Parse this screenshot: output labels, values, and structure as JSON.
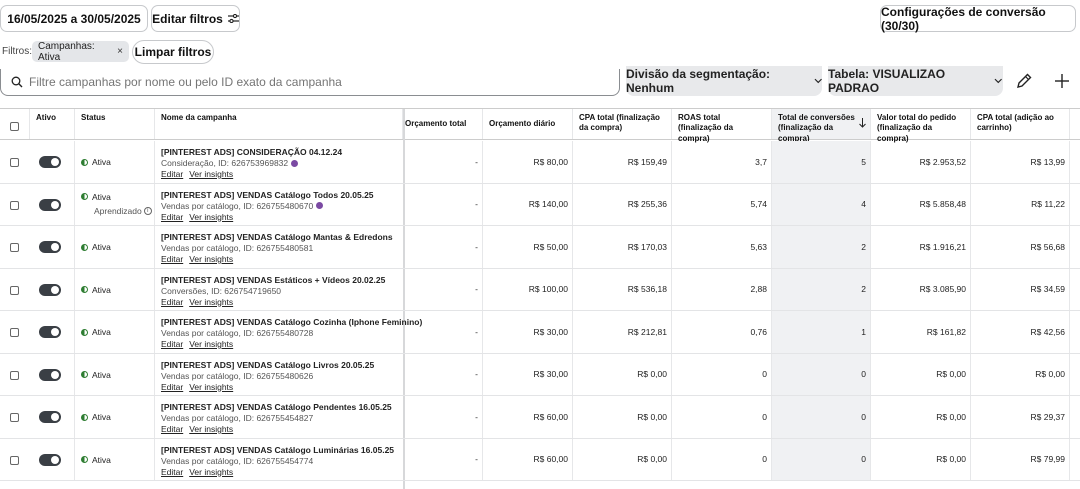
{
  "toolbar": {
    "date_range": "16/05/2025 a 30/05/2025",
    "edit_filters": "Editar filtros",
    "conversion_settings": "Configurações de conversão (30/30)"
  },
  "filters": {
    "label": "Filtros:",
    "chip": "Campanhas: Ativa",
    "chip_close": "×",
    "clear": "Limpar filtros"
  },
  "search": {
    "placeholder": "Filtre campanhas por nome ou pelo ID exato da campanha"
  },
  "segmentation": "Divisão da segmentação: Nenhum",
  "table_view": "Tabela: VISUALIZAO PADRAO",
  "columns": [
    "Ativo",
    "Status",
    "Nome da campanha",
    "Orçamento total",
    "Orçamento diário",
    "CPA total (finalização da compra)",
    "ROAS total (finalização da compra)",
    "Total de conversões (finalização da compra)",
    "Valor total do pedido (finalização da compra)",
    "CPA total (adição ao carrinho)"
  ],
  "row_links": {
    "edit": "Editar",
    "insights": "Ver insights"
  },
  "learning_label": "Aprendizado",
  "rows": [
    {
      "name": "[PINTEREST ADS] CONSIDERAÇÃO 04.12.24",
      "sub": "Consideração, ID: 626753969832",
      "status": "Ativa",
      "total_budget": "-",
      "daily": "R$ 80,00",
      "cpa": "R$ 159,49",
      "roas": "3,7",
      "conv": "5",
      "value": "R$ 2.953,52",
      "cpa_cart": "R$ 13,99",
      "dot": true,
      "learning": false
    },
    {
      "name": "[PINTEREST ADS] VENDAS Catálogo Todos 20.05.25",
      "sub": "Vendas por catálogo, ID: 626755480670",
      "status": "Ativa",
      "total_budget": "-",
      "daily": "R$ 140,00",
      "cpa": "R$ 255,36",
      "roas": "5,74",
      "conv": "4",
      "value": "R$ 5.858,48",
      "cpa_cart": "R$ 11,22",
      "dot": true,
      "learning": true
    },
    {
      "name": "[PINTEREST ADS] VENDAS Catálogo Mantas & Edredons",
      "sub": "Vendas por catálogo, ID: 626755480581",
      "status": "Ativa",
      "total_budget": "-",
      "daily": "R$ 50,00",
      "cpa": "R$ 170,03",
      "roas": "5,63",
      "conv": "2",
      "value": "R$ 1.916,21",
      "cpa_cart": "R$ 56,68",
      "dot": false,
      "learning": false
    },
    {
      "name": "[PINTEREST ADS] VENDAS Estáticos + Vídeos 20.02.25",
      "sub": "Conversões, ID: 626754719650",
      "status": "Ativa",
      "total_budget": "-",
      "daily": "R$ 100,00",
      "cpa": "R$ 536,18",
      "roas": "2,88",
      "conv": "2",
      "value": "R$ 3.085,90",
      "cpa_cart": "R$ 34,59",
      "dot": false,
      "learning": false
    },
    {
      "name": "[PINTEREST ADS] VENDAS Catálogo Cozinha (Iphone Feminino)",
      "sub": "Vendas por catálogo, ID: 626755480728",
      "status": "Ativa",
      "total_budget": "-",
      "daily": "R$ 30,00",
      "cpa": "R$ 212,81",
      "roas": "0,76",
      "conv": "1",
      "value": "R$ 161,82",
      "cpa_cart": "R$ 42,56",
      "dot": false,
      "learning": false
    },
    {
      "name": "[PINTEREST ADS] VENDAS Catálogo Livros 20.05.25",
      "sub": "Vendas por catálogo, ID: 626755480626",
      "status": "Ativa",
      "total_budget": "-",
      "daily": "R$ 30,00",
      "cpa": "R$ 0,00",
      "roas": "0",
      "conv": "0",
      "value": "R$ 0,00",
      "cpa_cart": "R$ 0,00",
      "dot": false,
      "learning": false
    },
    {
      "name": "[PINTEREST ADS] VENDAS Catálogo Pendentes 16.05.25",
      "sub": "Vendas por catálogo, ID: 626755454827",
      "status": "Ativa",
      "total_budget": "-",
      "daily": "R$ 60,00",
      "cpa": "R$ 0,00",
      "roas": "0",
      "conv": "0",
      "value": "R$ 0,00",
      "cpa_cart": "R$ 29,37",
      "dot": false,
      "learning": false
    },
    {
      "name": "[PINTEREST ADS] VENDAS Catálogo Luminárias 16.05.25",
      "sub": "Vendas por catálogo, ID: 626755454774",
      "status": "Ativa",
      "total_budget": "-",
      "daily": "R$ 60,00",
      "cpa": "R$ 0,00",
      "roas": "0",
      "conv": "0",
      "value": "R$ 0,00",
      "cpa_cart": "R$ 79,99",
      "dot": false,
      "learning": false
    }
  ]
}
